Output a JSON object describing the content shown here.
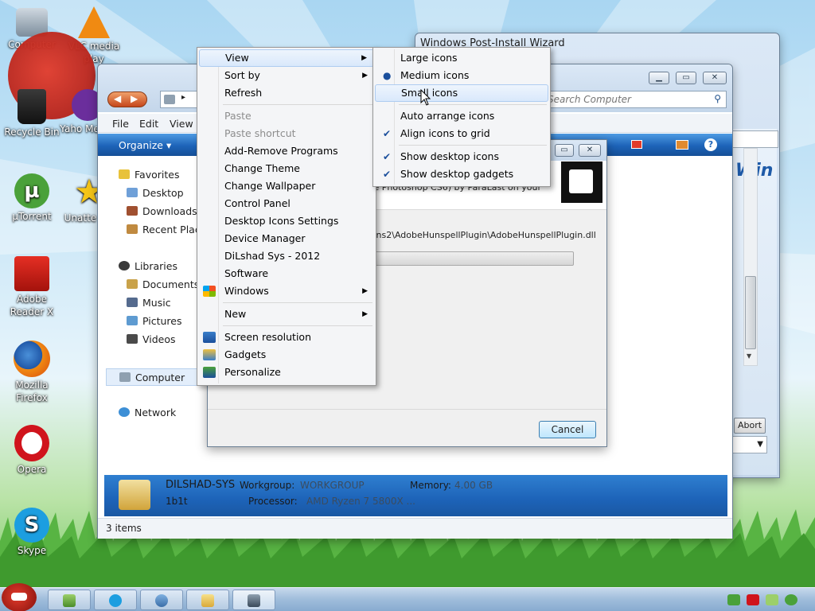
{
  "desktop": {
    "icons": [
      {
        "label": "Computer"
      },
      {
        "label": "VLC media play"
      },
      {
        "label": "Recycle Bin"
      },
      {
        "label": "Yaho Messe"
      },
      {
        "label": "µTorrent"
      },
      {
        "label": "Unatte Sol"
      },
      {
        "label": "Adobe Reader X"
      },
      {
        "label": "Mozilla Firefox"
      },
      {
        "label": "Opera"
      },
      {
        "label": "Skype"
      }
    ]
  },
  "wizard": {
    "title": "Windows Post-Install Wizard",
    "abort_label": "Abort",
    "side_text": "Win"
  },
  "explorer": {
    "search_placeholder": "Search Computer",
    "menubar": {
      "file": "File",
      "edit": "Edit",
      "view": "View"
    },
    "organize_label": "Organize",
    "nav": {
      "favorites": "Favorites",
      "desktop": "Desktop",
      "downloads": "Downloads",
      "recent": "Recent Plac",
      "libraries": "Libraries",
      "documents": "Documents",
      "music": "Music",
      "pictures": "Pictures",
      "videos": "Videos",
      "computer": "Computer",
      "network": "Network"
    },
    "details": {
      "name": "DILSHAD-SYS",
      "workgroup_label": "Workgroup:",
      "workgroup_value": "WORKGROUP",
      "memory_label": "Memory:",
      "memory_value": "4.00 GB",
      "user": "1b1t",
      "processor_label": "Processor:",
      "processor_value": "AMD Ryzen 7 5800X ..."
    },
    "status": "3 items"
  },
  "progress_dialog": {
    "partial_line": "...e Photoshop CS6) by ParaLast on your",
    "path": "...ins2\\AdobeHunspellPlugin\\AdobeHunspellPlugin.dll",
    "cancel_label": "Cancel",
    "progress": 0
  },
  "context_menu": {
    "view": "View",
    "sort_by": "Sort by",
    "refresh": "Refresh",
    "paste": "Paste",
    "paste_shortcut": "Paste shortcut",
    "add_remove": "Add-Remove Programs",
    "change_theme": "Change Theme",
    "change_wallpaper": "Change Wallpaper",
    "control_panel": "Control Panel",
    "desktop_icons_settings": "Desktop Icons Settings",
    "device_manager": "Device Manager",
    "dilshad_sys": "DiLshad Sys - 2012",
    "software": "Software",
    "windows": "Windows",
    "new": "New",
    "screen_resolution": "Screen resolution",
    "gadgets": "Gadgets",
    "personalize": "Personalize"
  },
  "view_submenu": {
    "large_icons": "Large icons",
    "medium_icons": "Medium icons",
    "small_icons": "Small icons",
    "auto_arrange": "Auto arrange icons",
    "align_to_grid": "Align icons to grid",
    "show_desktop_icons": "Show desktop icons",
    "show_desktop_gadgets": "Show desktop gadgets",
    "selected": "Medium icons",
    "checked": [
      "Align icons to grid",
      "Show desktop icons",
      "Show desktop gadgets"
    ]
  },
  "colors": {
    "accent_blue": "#1d63b8",
    "menu_highlight": "#d9e8fb",
    "checkmark": "#1b4f9c"
  }
}
